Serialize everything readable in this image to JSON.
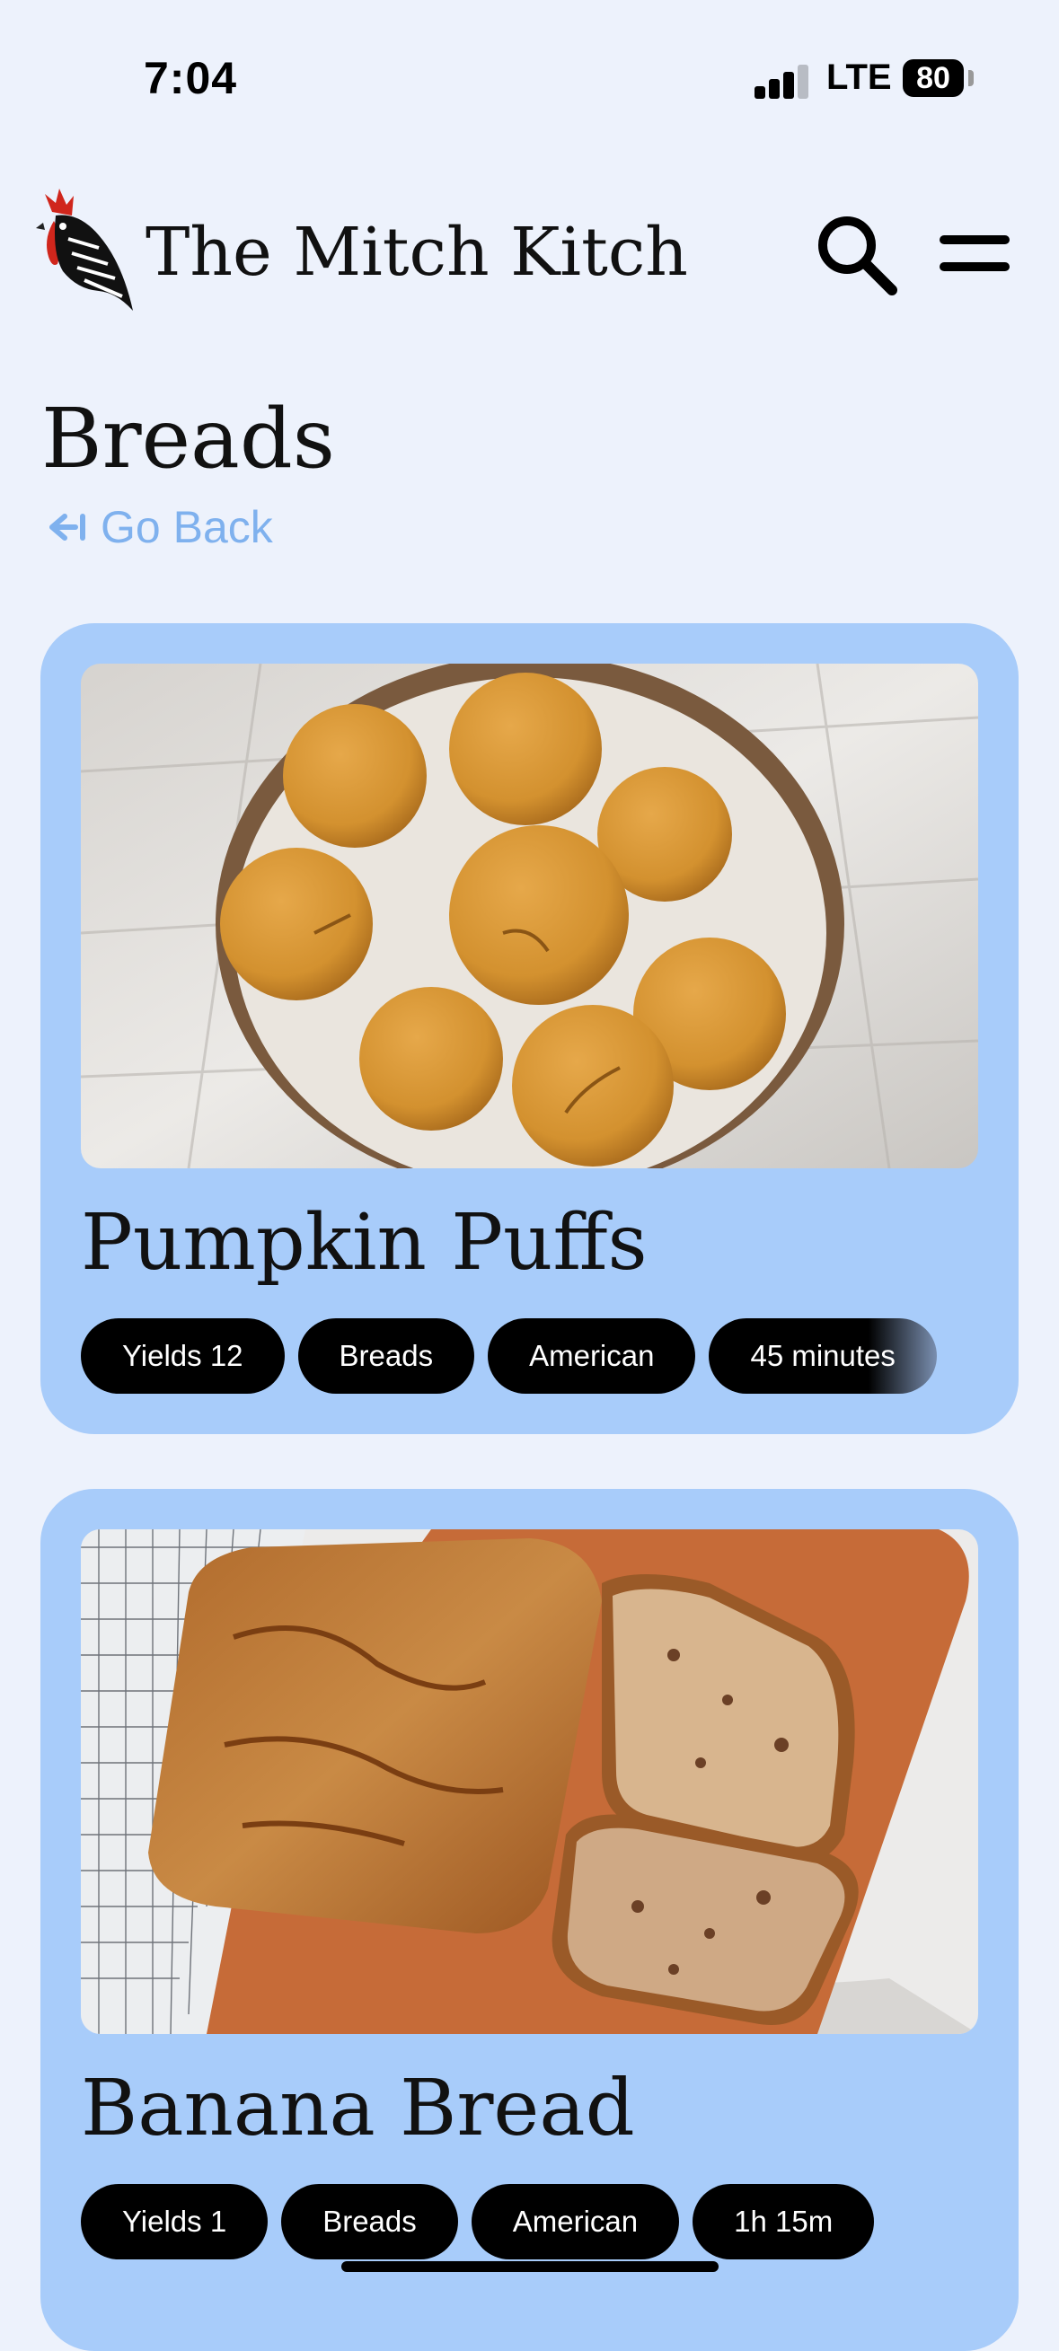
{
  "status": {
    "time": "7:04",
    "network": "LTE",
    "battery": "80"
  },
  "header": {
    "site_title": "The Mitch Kitch"
  },
  "page": {
    "title": "Breads",
    "back_label": "Go Back"
  },
  "recipes": [
    {
      "title": "Pumpkin Puffs",
      "tags": [
        "Yields 12",
        "Breads",
        "American",
        "45 minutes"
      ]
    },
    {
      "title": "Banana Bread",
      "tags": [
        "Yields 1",
        "Breads",
        "American",
        "1h 15m"
      ]
    }
  ],
  "colors": {
    "background": "#edf2fc",
    "card": "#a8ccfa",
    "accent": "#7fb1ee",
    "tag": "#000000"
  }
}
